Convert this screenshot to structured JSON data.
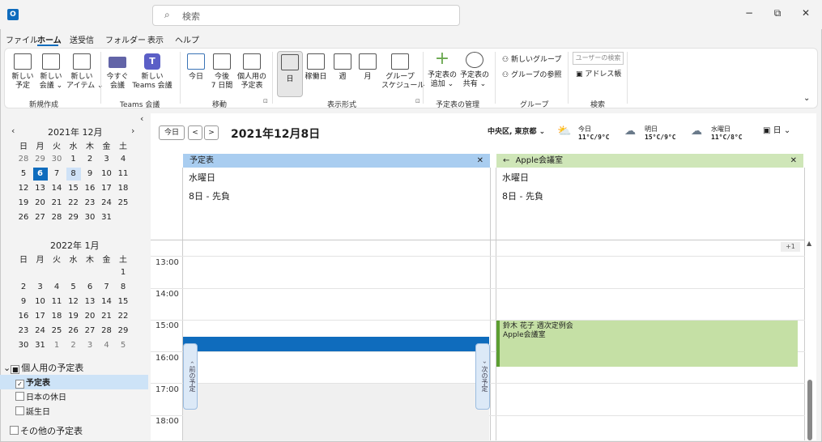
{
  "app": {
    "logo_letter": "O",
    "search_placeholder": "検索"
  },
  "window": {
    "minimize": "−",
    "restore": "⧉",
    "close": "✕"
  },
  "menu": {
    "items": [
      "ファイル",
      "ホーム",
      "送受信",
      "フォルダー",
      "表示",
      "ヘルプ"
    ],
    "active": "ホーム"
  },
  "ribbon": {
    "new": {
      "new_appt": [
        "新しい",
        "予定"
      ],
      "new_meeting": [
        "新しい",
        "会議 ⌄"
      ],
      "new_items": [
        "新しい",
        "アイテム ⌄"
      ],
      "group": "新規作成"
    },
    "teams": {
      "meet_now": [
        "今すぐ",
        "会議"
      ],
      "new_teams": [
        "新しい",
        "Teams 会議"
      ],
      "group": "Teams 会議"
    },
    "goto": {
      "today": "今日",
      "next7": [
        "今後",
        "7 日間"
      ],
      "personal": [
        "個人用の",
        "予定表"
      ],
      "group": "移動"
    },
    "arrange": {
      "day": "日",
      "workweek": "稼働日",
      "week": "週",
      "month": "月",
      "schedule": [
        "グループ",
        "スケジュール"
      ],
      "group": "表示形式"
    },
    "manage": {
      "add": [
        "予定表の",
        "追加 ⌄"
      ],
      "share": [
        "予定表の",
        "共有 ⌄"
      ],
      "group": "予定表の管理"
    },
    "groups": {
      "new_group": "新しいグループ",
      "browse": "グループの参照",
      "group": "グループ"
    },
    "find": {
      "search_people": "ユーザーの検索",
      "address_book": "アドレス帳",
      "group": "検索"
    }
  },
  "mini_cal": {
    "month1": "2021年 12月",
    "month2": "2022年 1月",
    "weekdays": [
      "日",
      "月",
      "火",
      "水",
      "木",
      "金",
      "土"
    ],
    "dec_rows": [
      [
        "28",
        "29",
        "30",
        "1",
        "2",
        "3",
        "4"
      ],
      [
        "5",
        "6",
        "7",
        "8",
        "9",
        "10",
        "11"
      ],
      [
        "12",
        "13",
        "14",
        "15",
        "16",
        "17",
        "18"
      ],
      [
        "19",
        "20",
        "21",
        "22",
        "23",
        "24",
        "25"
      ],
      [
        "26",
        "27",
        "28",
        "29",
        "30",
        "31",
        ""
      ]
    ],
    "jan_rows": [
      [
        "",
        "",
        "",
        "",
        "",
        "",
        "1"
      ],
      [
        "2",
        "3",
        "4",
        "5",
        "6",
        "7",
        "8"
      ],
      [
        "9",
        "10",
        "11",
        "12",
        "13",
        "14",
        "15"
      ],
      [
        "16",
        "17",
        "18",
        "19",
        "20",
        "21",
        "22"
      ],
      [
        "23",
        "24",
        "25",
        "26",
        "27",
        "28",
        "29"
      ],
      [
        "30",
        "31",
        "1",
        "2",
        "3",
        "4",
        "5"
      ]
    ],
    "today": "6",
    "selected": "8"
  },
  "folders": {
    "my_calendars": "個人用の予定表",
    "items": [
      "予定表",
      "日本の休日",
      "誕生日"
    ],
    "other": "その他の予定表"
  },
  "toolbar": {
    "today": "今日",
    "prev": "<",
    "next": ">",
    "date": "2021年12月8日",
    "location": "中央区, 東京都 ⌄",
    "view": "日 ⌄"
  },
  "weather": [
    {
      "day": "今日",
      "temp": "11°C/9°C"
    },
    {
      "day": "明日",
      "temp": "15°C/9°C"
    },
    {
      "day": "水曜日",
      "temp": "11°C/8°C"
    }
  ],
  "columns": [
    {
      "name": "予定表",
      "weekday": "水曜日",
      "rokuyo": "8日 - 先負",
      "color": "#a9cdf0"
    },
    {
      "name": "Apple会議室",
      "back": "←",
      "weekday": "水曜日",
      "rokuyo": "8日 - 先負",
      "color": "#cfe6b8"
    }
  ],
  "more_badge": "+1",
  "times": [
    "13:00",
    "14:00",
    "15:00",
    "16:00",
    "17:00",
    "18:00"
  ],
  "event": {
    "title": "鈴木 花子 週次定例会",
    "location": "Apple会議室",
    "color": "#c5e0a5",
    "bar": "#5c9e31"
  },
  "prev_appt": "前の予定",
  "next_appt": "次の予定"
}
